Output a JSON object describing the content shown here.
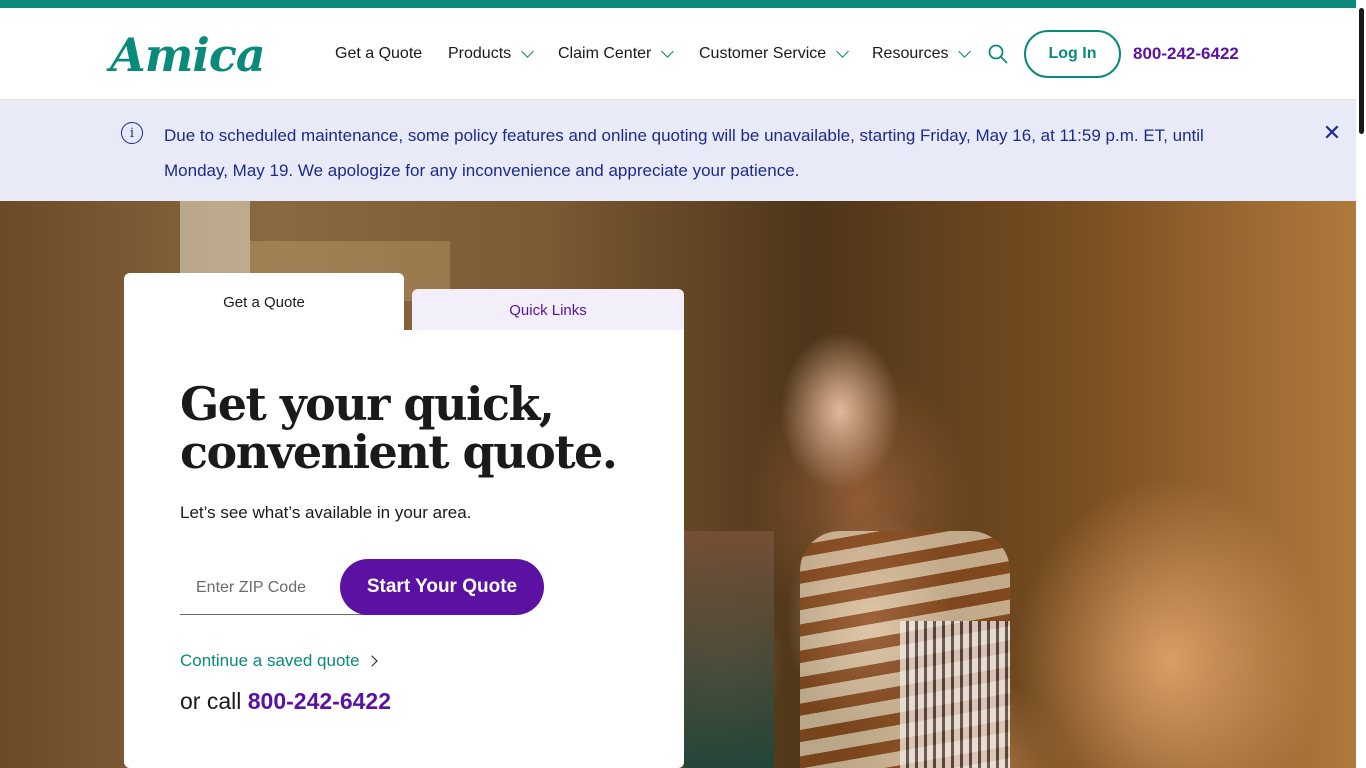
{
  "brand": {
    "logo": "Amica",
    "accent": "#0a8a7a",
    "purple": "#5b12a3",
    "alert_text_color": "#1c2a8c"
  },
  "nav": {
    "items": [
      {
        "label": "Get a Quote",
        "dropdown": false
      },
      {
        "label": "Products",
        "dropdown": true
      },
      {
        "label": "Claim Center",
        "dropdown": true
      },
      {
        "label": "Customer Service",
        "dropdown": true
      },
      {
        "label": "Resources",
        "dropdown": true
      }
    ],
    "search_icon": "search-icon",
    "login_label": "Log In",
    "phone": "800-242-6422"
  },
  "alert": {
    "icon": "info-icon",
    "message": "Due to scheduled maintenance, some policy features and online quoting will be unavailable, starting Friday, May 16, at 11:59 p.m. ET, until Monday, May 19. We apologize for any inconvenience and appreciate your patience.",
    "close_icon": "close-icon",
    "close_glyph": "✕"
  },
  "quote_panel": {
    "tabs": [
      {
        "label": "Get a Quote",
        "active": true
      },
      {
        "label": "Quick Links",
        "active": false
      }
    ],
    "headline": "Get your quick, convenient quote.",
    "subtext": "Let’s see what’s available in your area.",
    "zip_placeholder": "Enter ZIP Code",
    "zip_value": "",
    "start_label": "Start Your Quote",
    "continue_label": "Continue a saved quote",
    "call_prefix": "or call",
    "call_number": "800-242-6422"
  }
}
